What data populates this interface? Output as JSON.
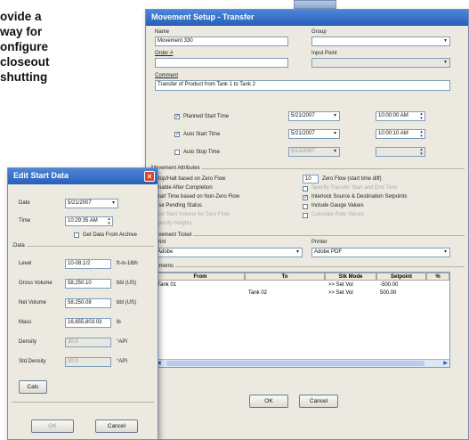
{
  "caption": "ovide a\nway for\nonfigure\ncloseout\nshutting",
  "main_window": {
    "title": "Movement Setup - Transfer",
    "name_label": "Name",
    "name_value": "Movement 330",
    "group_label": "Group",
    "group_value": "",
    "order_label": "Order #",
    "order_value": "",
    "input_point_label": "Input Point",
    "input_point_value": "",
    "comment_label": "Comment",
    "comment_value": "Transfer of Product from Tank 1 to Tank 2",
    "planned_start_label": "Planned Start Time",
    "planned_start_date": "5/21/2007",
    "planned_start_time": "10:00:00 AM",
    "auto_start_label": "Auto Start Time",
    "auto_start_date": "5/21/2007",
    "auto_start_time": "10:00:10 AM",
    "auto_stop_label": "Auto Stop Time",
    "auto_stop_date": "5/21/2007",
    "auto_stop_time": "",
    "movement_attributes_label": "Movement Attributes",
    "attr_left": [
      "Stop/Halt based on Zero Flow",
      "Enable After Completion",
      "Start Time based on Non-Zero Flow",
      "Use Pending Status",
      "Use Start Volume for Zero Flow",
      "Specify Heights"
    ],
    "zero_flow_value": "10",
    "zero_flow_text": "Zero Flow (start time diff)",
    "attr_right": [
      "Specify Transfer Start and End Time",
      "Interlock Source & Destination Setpoints",
      "Include Gauge Values",
      "Calculate Rate Values"
    ],
    "movement_ticket_label": "Movement Ticket",
    "print_label": "Print",
    "print_value": "Adobe",
    "printer_label": "Printer",
    "printer_value": "Adobe PDF",
    "elements_label": "Elements",
    "columns": [
      "From",
      "To",
      "Stk Mode",
      "Setpoint",
      "%"
    ],
    "rows": [
      {
        "from": "Tank 01",
        "to": "",
        "mode": ">> Set Vol",
        "setpoint": "-500.00",
        "pct": ""
      },
      {
        "from": "",
        "to": "Tank 02",
        "mode": ">> Set Vol",
        "setpoint": "500.00",
        "pct": ""
      }
    ],
    "ok_label": "OK",
    "cancel_label": "Cancel"
  },
  "dialog": {
    "title": "Edit Start Data",
    "date_label": "Date",
    "date_value": "5/21/2007",
    "time_label": "Time",
    "time_value": "10:29:35 AM",
    "get_data_label": "Get Data From Archive",
    "data_label": "Data",
    "level_label": "Level",
    "level_value": "10-08.1/2",
    "level_unit": "ft-in-16th",
    "gross_label": "Gross Volume",
    "gross_value": "58,250.10",
    "gross_unit": "bbl (US)",
    "net_label": "Net Volume",
    "net_value": "58,250.08",
    "net_unit": "bbl (US)",
    "mass_label": "Mass",
    "mass_value": "16,655,803.03",
    "mass_unit": "lb",
    "density_label": "Density",
    "density_value": "30.0",
    "density_unit": "°API",
    "stddensity_label": "Std.Density",
    "stddensity_value": "30.0",
    "stddensity_unit": "°API",
    "calc_label": "Calc",
    "ok_label": "OK",
    "cancel_label": "Cancel"
  },
  "colors": {
    "titlebar": "#2a5fb8",
    "close_button": "#d9452f",
    "window_bg": "#eceae0"
  }
}
